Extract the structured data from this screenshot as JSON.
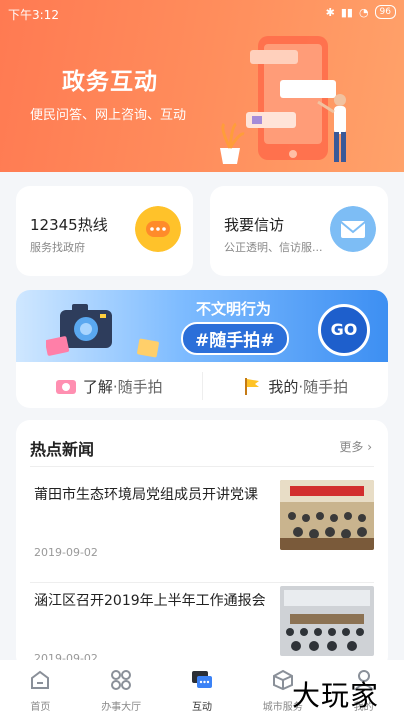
{
  "status": {
    "time": "下午3:12",
    "battery": "96"
  },
  "header": {
    "title": "政务互动",
    "subtitle": "便民问答、网上咨询、互动"
  },
  "cards": {
    "hotline": {
      "title": "12345热线",
      "subtitle": "服务找政府"
    },
    "petition": {
      "title": "我要信访",
      "subtitle": "公正透明、信访服..."
    }
  },
  "banner": {
    "line1": "不文明行为",
    "line2": "#随手拍#",
    "go": "GO",
    "learn_strong": "了解",
    "learn_rest": "·随手拍",
    "mine_strong": "我的",
    "mine_rest": "·随手拍"
  },
  "news": {
    "heading": "热点新闻",
    "more": "更多",
    "items": [
      {
        "title": "莆田市生态环境局党组成员开讲党课",
        "date": "2019-09-02"
      },
      {
        "title": "涵江区召开2019年上半年工作通报会",
        "date": "2019-09-02"
      }
    ]
  },
  "tabbar": {
    "tabs": [
      {
        "label": "首页"
      },
      {
        "label": "办事大厅"
      },
      {
        "label": "互动"
      },
      {
        "label": "城市服务"
      },
      {
        "label": "我的"
      }
    ]
  },
  "watermark": "大玩家",
  "colors": {
    "header": "#ff7f55",
    "accent_blue": "#3d8ff2",
    "hotline_icon": "#ffc22a",
    "petition_icon": "#7dbdf5"
  }
}
